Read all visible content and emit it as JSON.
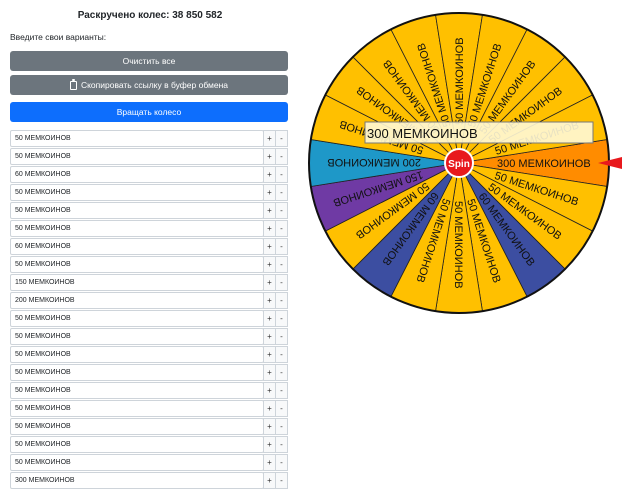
{
  "header": {
    "counter": "Раскручено колес: 38 850 582",
    "prompt": "Введите свои варианты:"
  },
  "buttons": {
    "clear": "Очистить все",
    "copy": "Скопировать ссылку в буфер обмена",
    "spin": "Вращать колесо"
  },
  "options": [
    "50 МЕМКОИНОВ",
    "50 МЕМКОИНОВ",
    "60 МЕМКОИНОВ",
    "50 МЕМКОИНОВ",
    "50 МЕМКОИНОВ",
    "50 МЕМКОИНОВ",
    "60 МЕМКОИНОВ",
    "50 МЕМКОИНОВ",
    "150 МЕМКОИНОВ",
    "200 МЕМКОИНОВ",
    "50 МЕМКОИНОВ",
    "50 МЕМКОИНОВ",
    "50 МЕМКОИНОВ",
    "50 МЕМКОИНОВ",
    "50 МЕМКОИНОВ",
    "50 МЕМКОИНОВ",
    "50 МЕМКОИНОВ",
    "50 МЕМКОИНОВ",
    "50 МЕМКОИНОВ",
    "300 МЕМКОИНОВ"
  ],
  "row_controls": {
    "plus": "+",
    "minus": "-"
  },
  "wheel": {
    "center_label": "Spin",
    "result": "300 МЕМКОИНОВ",
    "colors": {
      "gold": "#ffc000",
      "orange": "#ff8c00",
      "blue": "#3c4ea1",
      "teal": "#1e98c8",
      "purple": "#6f3aa4",
      "center": "#e8191d",
      "pointer": "#e8191d"
    },
    "segments": [
      {
        "label": "300 МЕМКОИНОВ",
        "color": "orange"
      },
      {
        "label": "50 МЕМКОИНОВ",
        "color": "gold"
      },
      {
        "label": "50 МЕМКОИНОВ",
        "color": "gold"
      },
      {
        "label": "60 МЕМКОИНОВ",
        "color": "blue"
      },
      {
        "label": "50 МЕМКОИНОВ",
        "color": "gold"
      },
      {
        "label": "50 МЕМКОИНОВ",
        "color": "gold"
      },
      {
        "label": "50 МЕМКОИНОВ",
        "color": "gold"
      },
      {
        "label": "60 МЕМКОИНОВ",
        "color": "blue"
      },
      {
        "label": "50 МЕМКОИНОВ",
        "color": "gold"
      },
      {
        "label": "150 МЕМКОИНОВ",
        "color": "purple"
      },
      {
        "label": "200 МЕМКОИНОВ",
        "color": "teal"
      },
      {
        "label": "50 МЕМКОИНОВ",
        "color": "gold"
      },
      {
        "label": "50 МЕМКОИНОВ",
        "color": "gold"
      },
      {
        "label": "50 МЕМКОИНОВ",
        "color": "gold"
      },
      {
        "label": "50 МЕМКОИНОВ",
        "color": "gold"
      },
      {
        "label": "50 МЕМКОИНОВ",
        "color": "gold"
      },
      {
        "label": "50 МЕМКОИНОВ",
        "color": "gold"
      },
      {
        "label": "50 МЕМКОИНОВ",
        "color": "gold"
      },
      {
        "label": "50 МЕМКОИНОВ",
        "color": "gold"
      },
      {
        "label": "50 МЕМКОИНОВ",
        "color": "gold"
      }
    ]
  }
}
